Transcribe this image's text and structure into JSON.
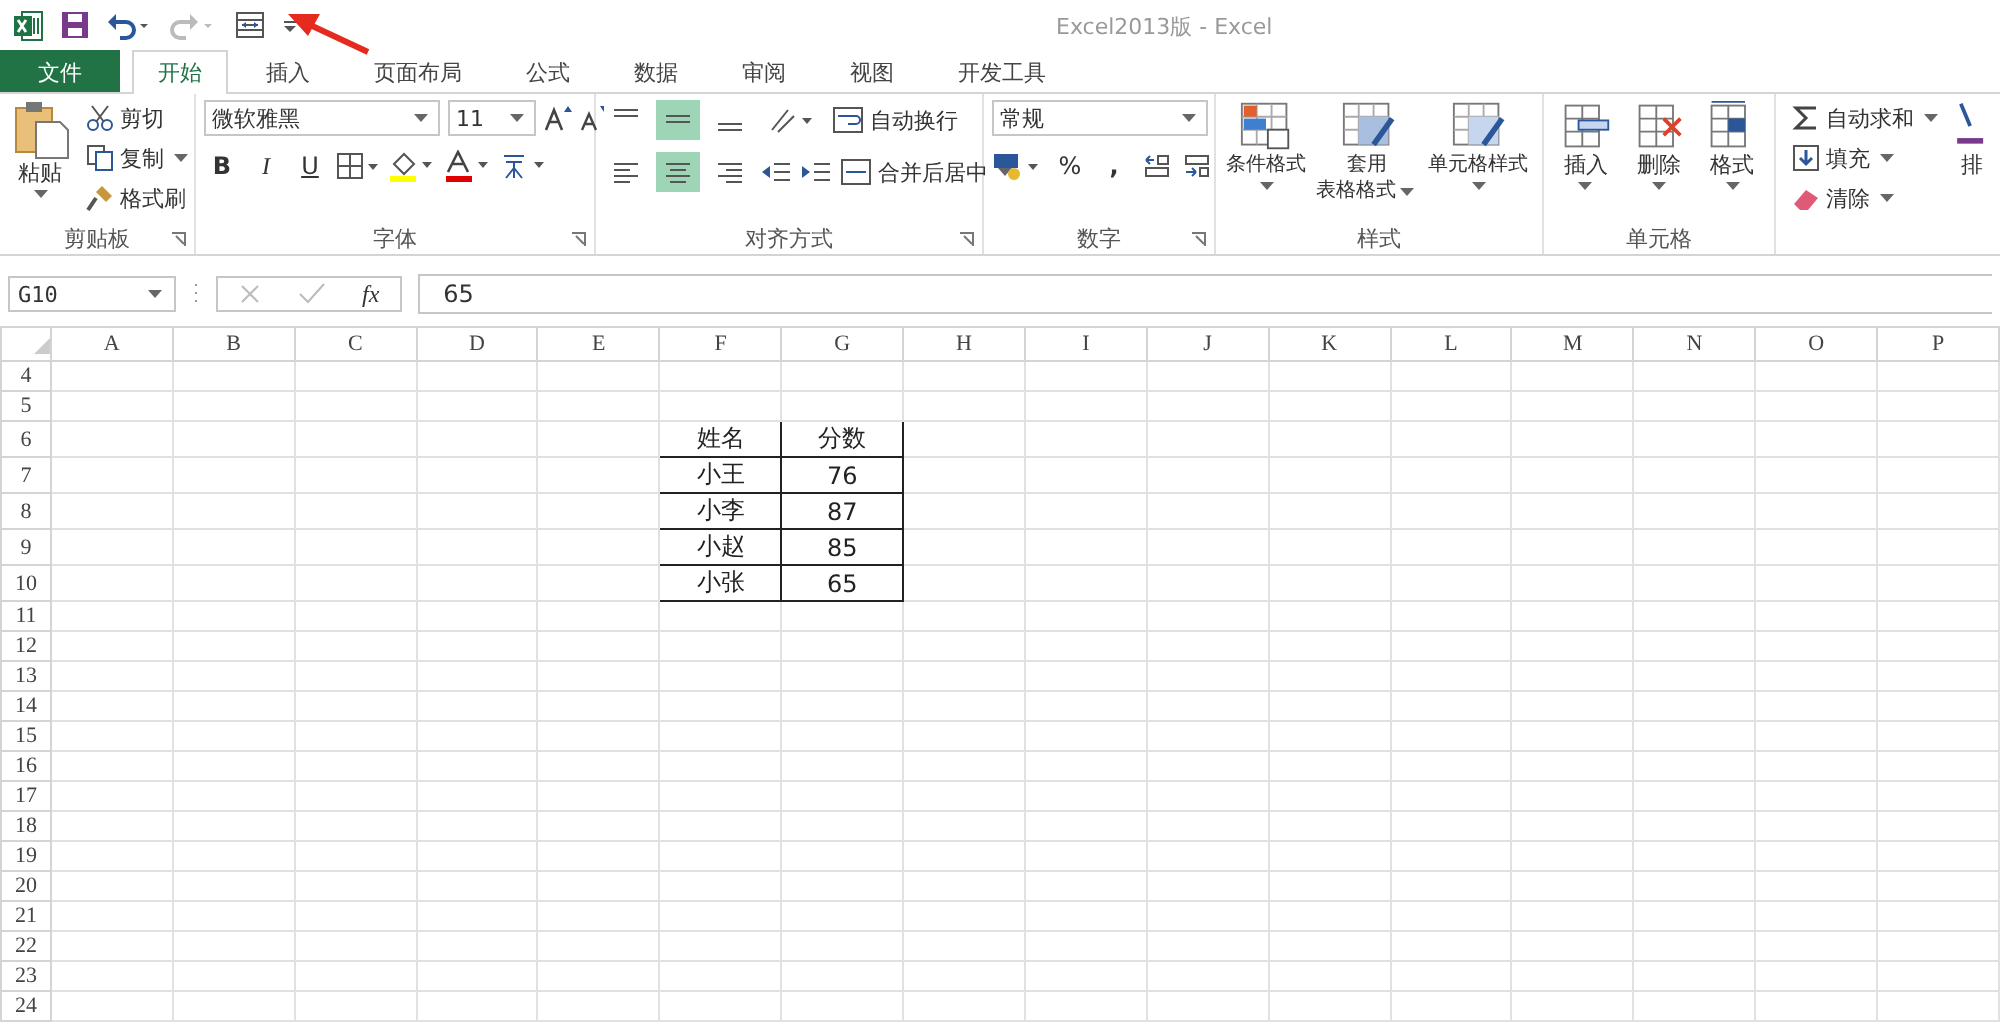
{
  "window": {
    "title": "Excel2013版 - Excel"
  },
  "quick_access": {
    "redo": {
      "disabled": true
    }
  },
  "tabs": [
    {
      "label": "文件",
      "kind": "file",
      "selected": false
    },
    {
      "label": "开始",
      "kind": "tab",
      "selected": true
    },
    {
      "label": "插入",
      "kind": "tab",
      "selected": false
    },
    {
      "label": "页面布局",
      "kind": "tab",
      "selected": false
    },
    {
      "label": "公式",
      "kind": "tab",
      "selected": false
    },
    {
      "label": "数据",
      "kind": "tab",
      "selected": false
    },
    {
      "label": "审阅",
      "kind": "tab",
      "selected": false
    },
    {
      "label": "视图",
      "kind": "tab",
      "selected": false
    },
    {
      "label": "开发工具",
      "kind": "tab",
      "selected": false
    }
  ],
  "ribbon": {
    "clipboard": {
      "label": "剪贴板",
      "paste": "粘贴",
      "cut": "剪切",
      "copy": "复制",
      "format_painter": "格式刷"
    },
    "font": {
      "label": "字体",
      "font_name": "微软雅黑",
      "font_size": "11",
      "bold": "B",
      "italic": "I",
      "underline": "U"
    },
    "alignment": {
      "label": "对齐方式",
      "vertical": [
        {
          "selected": false
        },
        {
          "selected": true
        },
        {
          "selected": false
        }
      ],
      "horizontal": [
        {
          "selected": false
        },
        {
          "selected": true
        },
        {
          "selected": false
        }
      ],
      "wrap_text": "自动换行",
      "merge_center": "合并后居中"
    },
    "number": {
      "label": "数字",
      "format": "常规",
      "percent": "%",
      "comma": ","
    },
    "styles": {
      "label": "样式",
      "buttons": [
        [
          "条件格式"
        ],
        [
          "套用",
          "表格格式"
        ],
        [
          "单元格样式"
        ]
      ]
    },
    "cells": {
      "label": "单元格",
      "buttons": [
        "插入",
        "删除",
        "格式"
      ]
    },
    "editing": {
      "autosum": "自动求和",
      "fill": "填充",
      "clear": "清除",
      "sort": "排"
    }
  },
  "formula_bar": {
    "name_box": "G10",
    "function_label": "fx",
    "value": "65"
  },
  "sheet": {
    "columns": [
      "A",
      "B",
      "C",
      "D",
      "E",
      "F",
      "G",
      "H",
      "I",
      "J",
      "K",
      "L",
      "M",
      "N",
      "O",
      "P"
    ],
    "rows": [
      {
        "header": "4"
      },
      {
        "header": "5"
      },
      {
        "header": "6",
        "cells": {
          "F": "姓名",
          "G": "分数"
        }
      },
      {
        "header": "7",
        "cells": {
          "F": "小王",
          "G": "76"
        }
      },
      {
        "header": "8",
        "cells": {
          "F": "小李",
          "G": "87"
        }
      },
      {
        "header": "9",
        "cells": {
          "F": "小赵",
          "G": "85"
        }
      },
      {
        "header": "10",
        "cells": {
          "F": "小张",
          "G": "65"
        }
      },
      {
        "header": "11"
      },
      {
        "header": "12"
      },
      {
        "header": "13"
      },
      {
        "header": "14"
      },
      {
        "header": "15"
      },
      {
        "header": "16"
      },
      {
        "header": "17"
      },
      {
        "header": "18"
      },
      {
        "header": "19"
      },
      {
        "header": "20"
      },
      {
        "header": "21"
      },
      {
        "header": "22"
      },
      {
        "header": "23"
      },
      {
        "header": "24"
      }
    ]
  }
}
